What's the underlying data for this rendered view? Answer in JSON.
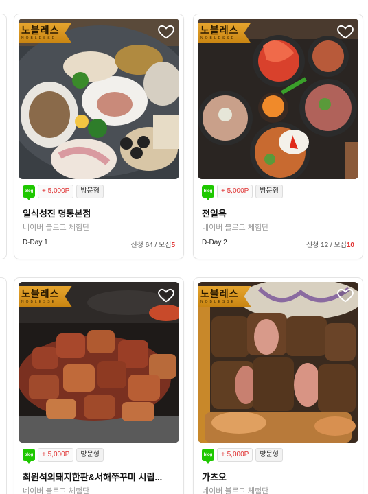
{
  "brand": {
    "name": "노블레스",
    "sub": "NOBLESSE"
  },
  "cards": [
    {
      "title": "일식성진 명동본점",
      "channel": "네이버 블로그 체험단",
      "blog_icon": "blog",
      "point": "+ 5,000P",
      "type": "방문형",
      "dday": "D-Day 1",
      "applied_label": "신청 64 / 모집",
      "recruit": "5",
      "favorite_icon": "heart-outline-icon"
    },
    {
      "title": "전일옥",
      "channel": "네이버 블로그 체험단",
      "blog_icon": "blog",
      "point": "+ 5,000P",
      "type": "방문형",
      "dday": "D-Day 2",
      "applied_label": "신청 12 / 모집",
      "recruit": "10",
      "favorite_icon": "heart-outline-icon"
    },
    {
      "title": "최원석의돼지한판&서해쭈꾸미 시립...",
      "channel": "네이버 블로그 체험단",
      "blog_icon": "blog",
      "point": "+ 5,000P",
      "type": "방문형",
      "favorite_icon": "heart-outline-icon"
    },
    {
      "title": "가츠오",
      "channel": "네이버 블로그 체험단",
      "blog_icon": "blog",
      "point": "+ 5,000P",
      "type": "방문형",
      "favorite_icon": "heart-outline-icon"
    }
  ],
  "colors": {
    "accent_red": "#e03131",
    "blog_green": "#1ec800",
    "badge_gold": "#d9971f"
  }
}
